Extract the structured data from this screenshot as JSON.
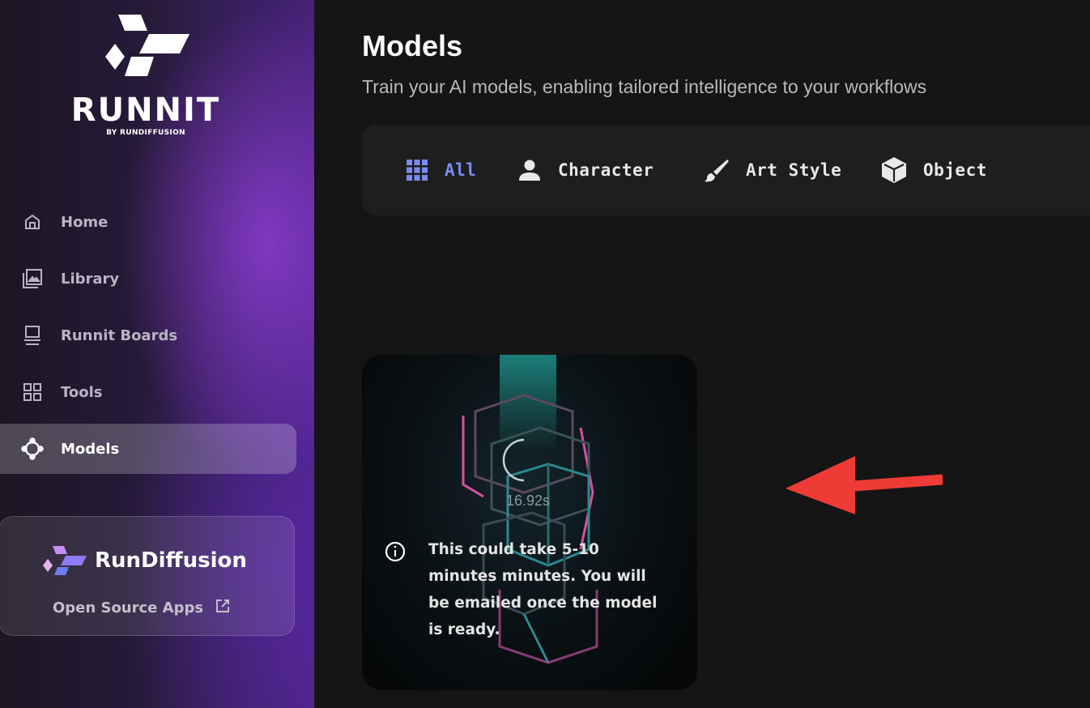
{
  "brand": {
    "logo_text": "RUNNIT",
    "logo_subtext": "BY RUNDIFFUSION"
  },
  "sidebar": {
    "items": [
      {
        "label": "Home",
        "icon": "home-icon"
      },
      {
        "label": "Library",
        "icon": "library-icon"
      },
      {
        "label": "Runnit Boards",
        "icon": "boards-icon"
      },
      {
        "label": "Tools",
        "icon": "tools-icon"
      },
      {
        "label": "Models",
        "icon": "models-icon",
        "active": true
      }
    ],
    "promo": {
      "brand_name": "RunDiffusion",
      "link_label": "Open Source Apps"
    }
  },
  "main": {
    "title": "Models",
    "subtitle": "Train your AI models, enabling tailored intelligence to your workflows",
    "filters": [
      {
        "label": "All",
        "icon": "grid-icon",
        "active": true
      },
      {
        "label": "Character",
        "icon": "person-icon"
      },
      {
        "label": "Art Style",
        "icon": "brush-icon"
      },
      {
        "label": "Object",
        "icon": "cube-icon"
      }
    ],
    "training_card": {
      "timer": "16.92s",
      "notice": "This could take 5-10 minutes minutes. You will be emailed once the model is ready."
    }
  },
  "colors": {
    "accent": "#7b8cf0",
    "annotation_arrow": "#ef3b36"
  }
}
